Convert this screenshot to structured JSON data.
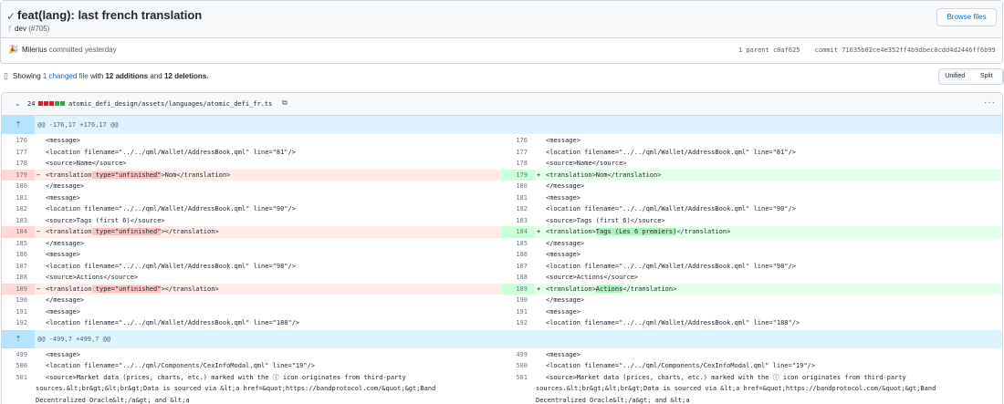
{
  "commit": {
    "title": "feat(lang): last french translation",
    "branch": "dev",
    "pr": "(#705)",
    "browse_label": "Browse files",
    "author": "Milerius",
    "committed": "committed yesterday",
    "parent_label": "1 parent",
    "parent_hash": "c8af625",
    "commit_label": "commit",
    "commit_hash": "71035b02ce4e352ff4b9dbec0cdd4d2446ff6b99"
  },
  "summary": {
    "prefix": "Showing",
    "files_link": "1 changed file",
    "with": "with",
    "additions": "12 additions",
    "and": "and",
    "deletions": "12 deletions."
  },
  "view_toggle": {
    "unified": "Unified",
    "split": "Split"
  },
  "file": {
    "changes": "24",
    "path": "atomic_defi_design/assets/languages/atomic_defi_fr.ts",
    "diff_blocks": [
      "#cf222e",
      "#cf222e",
      "#cf222e",
      "#2da44e",
      "#2da44e"
    ]
  },
  "hunk1": "@@ -176,17 +176,17 @@",
  "hunk2": "@@ -499,7 +499,7 @@",
  "lines1": [
    {
      "l": "176",
      "r": "176",
      "t": "n",
      "lc": "        <message>",
      "rc": "        <message>"
    },
    {
      "l": "177",
      "r": "177",
      "t": "n",
      "lc": "            <location filename=\"../../qml/Wallet/AddressBook.qml\" line=\"81\"/>",
      "rc": "            <location filename=\"../../qml/Wallet/AddressBook.qml\" line=\"81\"/>"
    },
    {
      "l": "178",
      "r": "178",
      "t": "n",
      "lc": "            <source>Name</source>",
      "rc": "            <source>Name</source>"
    },
    {
      "l": "179",
      "r": "179",
      "t": "c",
      "lc_pre": "            <translation",
      "lc_hl": " type=\"unfinished\"",
      "lc_post": ">Nom</translation>",
      "rc_pre": "            <translation>",
      "rc_hl": "",
      "rc_post": "Nom</translation>"
    },
    {
      "l": "180",
      "r": "180",
      "t": "n",
      "lc": "        </message>",
      "rc": "        </message>"
    },
    {
      "l": "181",
      "r": "181",
      "t": "n",
      "lc": "        <message>",
      "rc": "        <message>"
    },
    {
      "l": "182",
      "r": "182",
      "t": "n",
      "lc": "            <location filename=\"../../qml/Wallet/AddressBook.qml\" line=\"90\"/>",
      "rc": "            <location filename=\"../../qml/Wallet/AddressBook.qml\" line=\"90\"/>"
    },
    {
      "l": "183",
      "r": "183",
      "t": "n",
      "lc": "            <source>Tags (first 6)</source>",
      "rc": "            <source>Tags (first 6)</source>"
    },
    {
      "l": "184",
      "r": "184",
      "t": "c",
      "lc_pre": "            <translation",
      "lc_hl": " type=\"unfinished\"",
      "lc_post": "></translation>",
      "rc_pre": "            <translation>",
      "rc_hl": "Tags (Les 6 premiers)",
      "rc_post": "</translation>"
    },
    {
      "l": "185",
      "r": "185",
      "t": "n",
      "lc": "        </message>",
      "rc": "        </message>"
    },
    {
      "l": "186",
      "r": "186",
      "t": "n",
      "lc": "        <message>",
      "rc": "        <message>"
    },
    {
      "l": "187",
      "r": "187",
      "t": "n",
      "lc": "            <location filename=\"../../qml/Wallet/AddressBook.qml\" line=\"98\"/>",
      "rc": "            <location filename=\"../../qml/Wallet/AddressBook.qml\" line=\"98\"/>"
    },
    {
      "l": "188",
      "r": "188",
      "t": "n",
      "lc": "            <source>Actions</source>",
      "rc": "            <source>Actions</source>"
    },
    {
      "l": "189",
      "r": "189",
      "t": "c",
      "lc_pre": "            <translation",
      "lc_hl": " type=\"unfinished\"",
      "lc_post": "></translation>",
      "rc_pre": "            <translation>",
      "rc_hl": "Actions",
      "rc_post": "</translation>"
    },
    {
      "l": "190",
      "r": "190",
      "t": "n",
      "lc": "        </message>",
      "rc": "        </message>"
    },
    {
      "l": "191",
      "r": "191",
      "t": "n",
      "lc": "        <message>",
      "rc": "        <message>"
    },
    {
      "l": "192",
      "r": "192",
      "t": "n",
      "lc": "            <location filename=\"../../qml/Wallet/AddressBook.qml\" line=\"188\"/>",
      "rc": "            <location filename=\"../../qml/Wallet/AddressBook.qml\" line=\"188\"/>"
    }
  ],
  "lines2": [
    {
      "l": "499",
      "r": "499",
      "lc": "        <message>",
      "rc": "        <message>"
    },
    {
      "l": "500",
      "r": "500",
      "lc": "            <location filename=\"../../qml/Components/CexInfoModal.qml\" line=\"19\"/>",
      "rc": "            <location filename=\"../../qml/Components/CexInfoModal.qml\" line=\"19\"/>"
    },
    {
      "l": "501",
      "r": "501",
      "lc": "            <source>Market data (prices, charts, etc.) marked with the ⓘ icon originates from third-party",
      "rc": "            <source>Market data (prices, charts, etc.) marked with the ⓘ icon originates from third-party"
    }
  ],
  "wrap_lines": [
    "sources.&lt;br&gt;&lt;br&gt;Data is sourced via &lt;a href=&quot;https://bandprotocol.com/&quot;&gt;Band",
    "Decentralized Oracle&lt;/a&gt; and &lt;a"
  ]
}
